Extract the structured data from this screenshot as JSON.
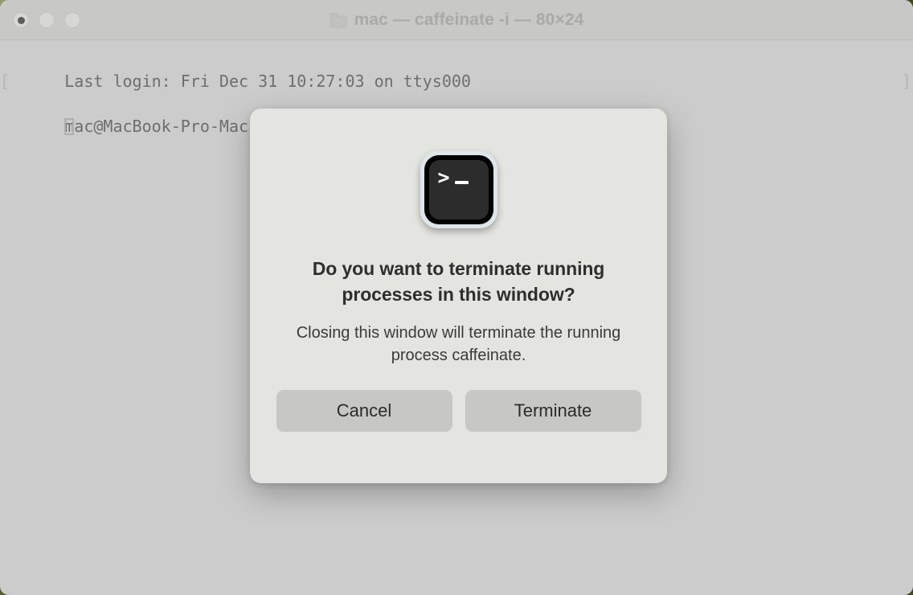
{
  "window": {
    "title": "mac — caffeinate -i — 80×24",
    "folder_icon": "folder-icon",
    "traffic_lights": [
      {
        "name": "close",
        "label": "Close"
      },
      {
        "name": "minimize",
        "label": "Minimize"
      },
      {
        "name": "zoom",
        "label": "Zoom"
      }
    ]
  },
  "terminal": {
    "lines": [
      {
        "text": "Last login: Fri Dec 31 10:27:03 on ttys000",
        "bracket_left": "",
        "bracket_right": ""
      },
      {
        "text": "mac@MacBook-Pro-Mac ~ % caffeinate -i",
        "bracket_left": "[",
        "bracket_right": "]"
      }
    ],
    "cursor": "block-outline-cursor"
  },
  "dialog": {
    "icon": "terminal-app-icon",
    "icon_prompt": ">",
    "heading": "Do you want to terminate running processes in this window?",
    "message": "Closing this window will terminate the running process caffeinate.",
    "buttons": [
      {
        "name": "cancel",
        "label": "Cancel"
      },
      {
        "name": "terminate",
        "label": "Terminate"
      }
    ]
  },
  "colors": {
    "window_body": "#cccccc",
    "titlebar": "#c8c8c6",
    "dialog_background": "#e4e4e0",
    "button_background": "#c7c7c3",
    "terminal_text": "#6e6e6c",
    "icon_screen": "#2c2c2c"
  }
}
